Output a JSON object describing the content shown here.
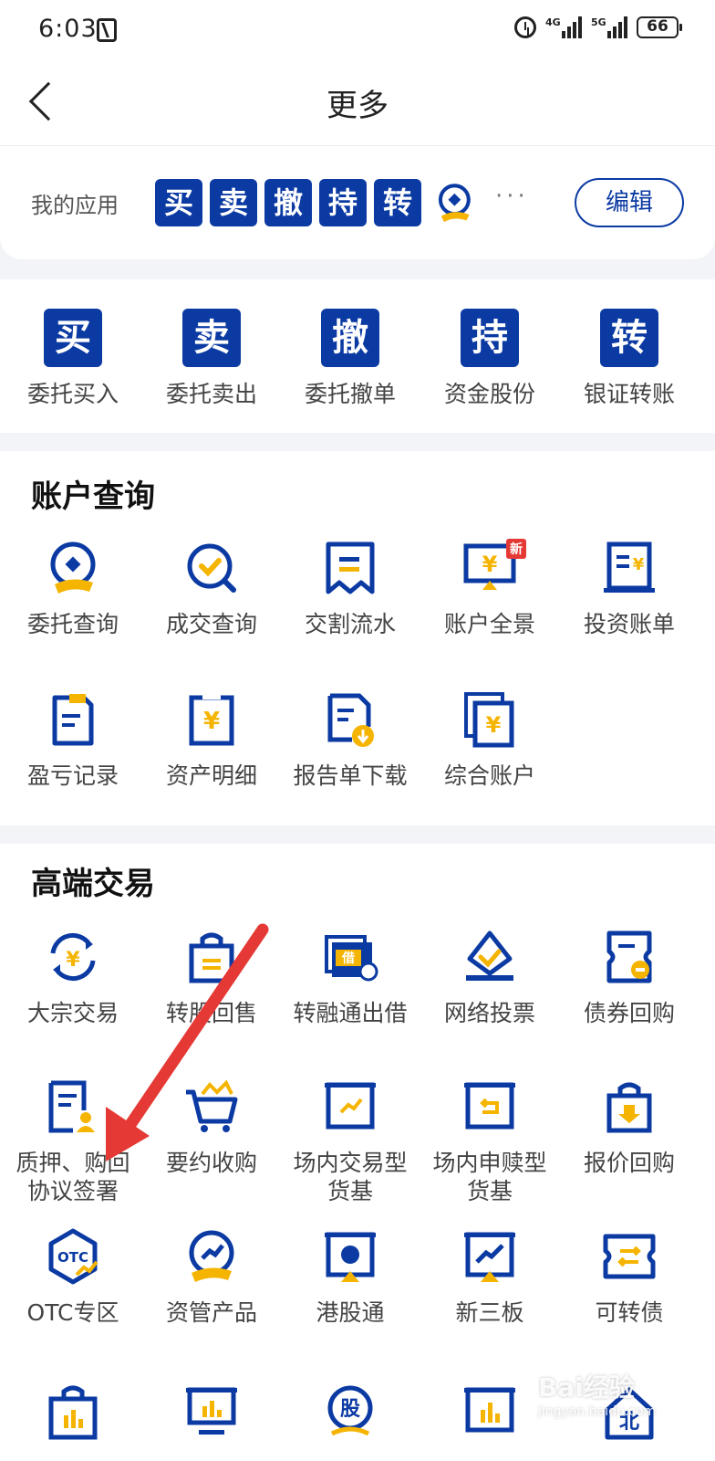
{
  "status_bar": {
    "time": "6:03",
    "battery": "66",
    "net1": "4G",
    "net2": "5G"
  },
  "header": {
    "title": "更多"
  },
  "my_apps": {
    "label": "我的应用",
    "chips": [
      "买",
      "卖",
      "撤",
      "持",
      "转"
    ],
    "more": "···",
    "edit_label": "编辑"
  },
  "quick_actions": [
    {
      "glyph": "买",
      "label": "委托买入"
    },
    {
      "glyph": "卖",
      "label": "委托卖出"
    },
    {
      "glyph": "撤",
      "label": "委托撤单"
    },
    {
      "glyph": "持",
      "label": "资金股份"
    },
    {
      "glyph": "转",
      "label": "银证转账"
    }
  ],
  "account_query": {
    "title": "账户查询",
    "items": [
      {
        "label": "委托查询",
        "icon": "entrust-query-icon"
      },
      {
        "label": "成交查询",
        "icon": "trade-query-icon"
      },
      {
        "label": "交割流水",
        "icon": "settlement-icon"
      },
      {
        "label": "账户全景",
        "icon": "account-overview-icon",
        "badge": "新"
      },
      {
        "label": "投资账单",
        "icon": "invest-bill-icon"
      },
      {
        "label": "盈亏记录",
        "icon": "pnl-record-icon"
      },
      {
        "label": "资产明细",
        "icon": "asset-detail-icon"
      },
      {
        "label": "报告单下载",
        "icon": "report-download-icon"
      },
      {
        "label": "综合账户",
        "icon": "combined-account-icon"
      }
    ]
  },
  "advanced_trading": {
    "title": "高端交易",
    "items": [
      {
        "label": "大宗交易",
        "icon": "block-trade-icon"
      },
      {
        "label": "转股回售",
        "icon": "convert-putback-icon"
      },
      {
        "label": "转融通出借",
        "icon": "refinance-lend-icon"
      },
      {
        "label": "网络投票",
        "icon": "online-vote-icon"
      },
      {
        "label": "债券回购",
        "icon": "bond-repo-icon"
      },
      {
        "label": "质押、购回",
        "label2": "协议签署",
        "icon": "pledge-agreement-icon"
      },
      {
        "label": "要约收购",
        "icon": "tender-offer-icon"
      },
      {
        "label": "场内交易型",
        "label2": "货基",
        "icon": "exchange-fund-icon"
      },
      {
        "label": "场内申赎型",
        "label2": "货基",
        "icon": "redeem-fund-icon"
      },
      {
        "label": "报价回购",
        "icon": "quote-repo-icon"
      },
      {
        "label": "OTC专区",
        "icon": "otc-icon"
      },
      {
        "label": "资管产品",
        "icon": "asset-mgmt-icon"
      },
      {
        "label": "港股通",
        "icon": "hk-connect-icon"
      },
      {
        "label": "新三板",
        "icon": "neeq-icon"
      },
      {
        "label": "可转债",
        "icon": "convertible-bond-icon"
      }
    ]
  },
  "bottom_row": [
    {
      "icon": "shopping-bag-chart-icon"
    },
    {
      "icon": "monitor-chart-icon"
    },
    {
      "icon": "stock-coin-icon",
      "text": "股"
    },
    {
      "icon": "board-chart-icon"
    },
    {
      "icon": "bse-house-icon",
      "text": "北"
    }
  ],
  "watermark": {
    "text": "Bai经验",
    "sub": "jingyan.baidu.com"
  },
  "colors": {
    "brand": "#0b3aa3",
    "accent": "#f5b400",
    "arrow": "#e53935"
  }
}
